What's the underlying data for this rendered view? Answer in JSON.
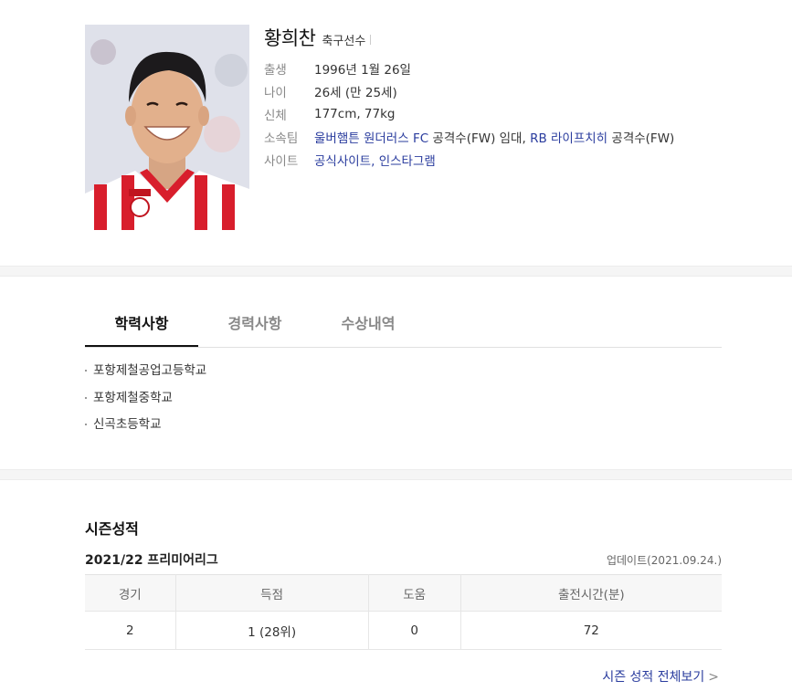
{
  "profile": {
    "name": "황희찬",
    "job": "축구선수",
    "rows": [
      {
        "label": "출생",
        "value": "1996년 1월 26일"
      },
      {
        "label": "나이",
        "value": "26세 (만 25세)"
      },
      {
        "label": "신체",
        "value": "177cm, 77kg"
      }
    ],
    "team": {
      "label": "소속팀",
      "club1": "울버햄튼 원더러스 FC",
      "pos1": " 공격수(FW) 임대, ",
      "club2": "RB 라이프치히",
      "pos2": " 공격수(FW)"
    },
    "site": {
      "label": "사이트",
      "official": "공식사이트",
      "sep": ", ",
      "instagram": "인스타그램"
    }
  },
  "tabs": [
    {
      "label": "학력사항",
      "active": true
    },
    {
      "label": "경력사항",
      "active": false
    },
    {
      "label": "수상내역",
      "active": false
    }
  ],
  "education": [
    "포항제철공업고등학교",
    "포항제철중학교",
    "신곡초등학교"
  ],
  "season": {
    "title": "시즌성적",
    "league": "2021/22 프리미어리그",
    "updated": "업데이트(2021.09.24.)",
    "headers": [
      "경기",
      "득점",
      "도움",
      "출전시간(분)"
    ],
    "values": [
      "2",
      "1 (28위)",
      "0",
      "72"
    ],
    "more_label": "시즌 성적 전체보기",
    "more_arrow": ">"
  },
  "colors": {
    "link": "#2a3c9e",
    "jersey_red": "#d81e2c"
  }
}
